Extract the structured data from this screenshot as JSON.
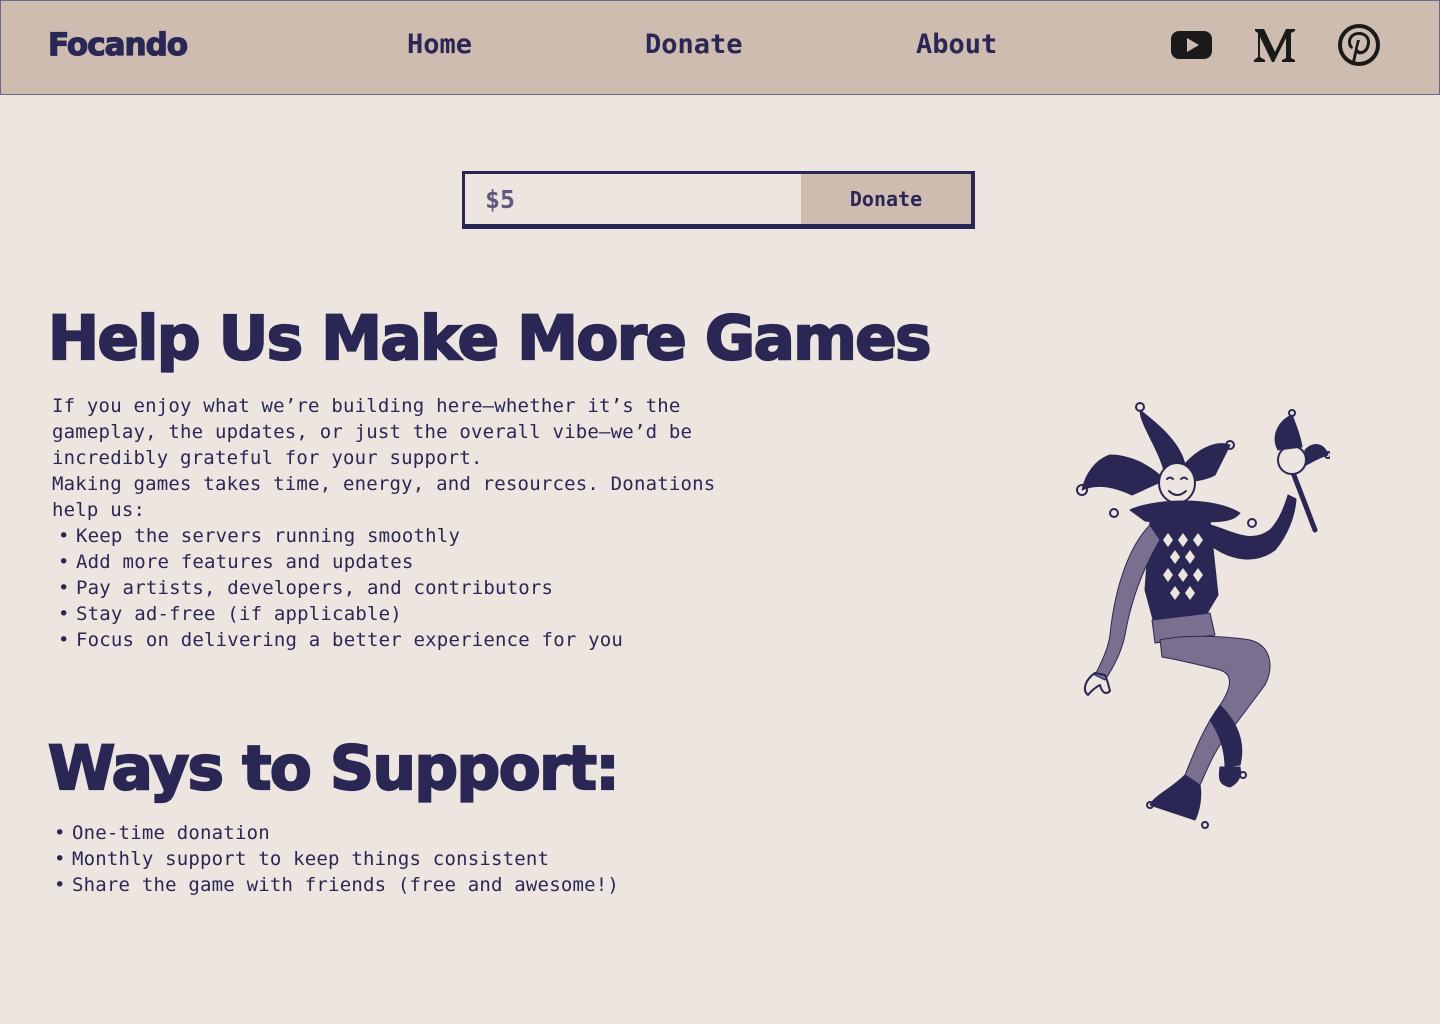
{
  "nav": {
    "brand": "Focando",
    "links": [
      "Home",
      "Donate",
      "About"
    ],
    "social_icons": [
      "youtube-icon",
      "medium-icon",
      "pinterest-icon"
    ]
  },
  "donate_form": {
    "amount_placeholder": "$5",
    "button_label": "Donate"
  },
  "section_help": {
    "title": "Help Us Make More Games",
    "paragraph_1": "If you enjoy what we’re building here—whether it’s the gameplay, the updates, or just the overall vibe—we’d be incredibly grateful for your support.",
    "paragraph_2": "Making games takes time, energy, and resources. Donations help us:",
    "items": [
      "Keep the servers running smoothly",
      "Add more features and updates",
      "Pay artists, developers, and contributors",
      "Stay ad-free (if applicable)",
      "Focus on delivering a better experience for you"
    ]
  },
  "section_ways": {
    "title": "Ways to Support:",
    "items": [
      "One-time donation",
      "Monthly support to keep things consistent",
      "Share the game with friends (free and awesome!)"
    ]
  },
  "illustration": "jester-illustration",
  "colors": {
    "background": "#ece5e0",
    "navbar": "#cfbcb1",
    "primary_text": "#2b2754",
    "input_text": "#5f5a7d"
  }
}
